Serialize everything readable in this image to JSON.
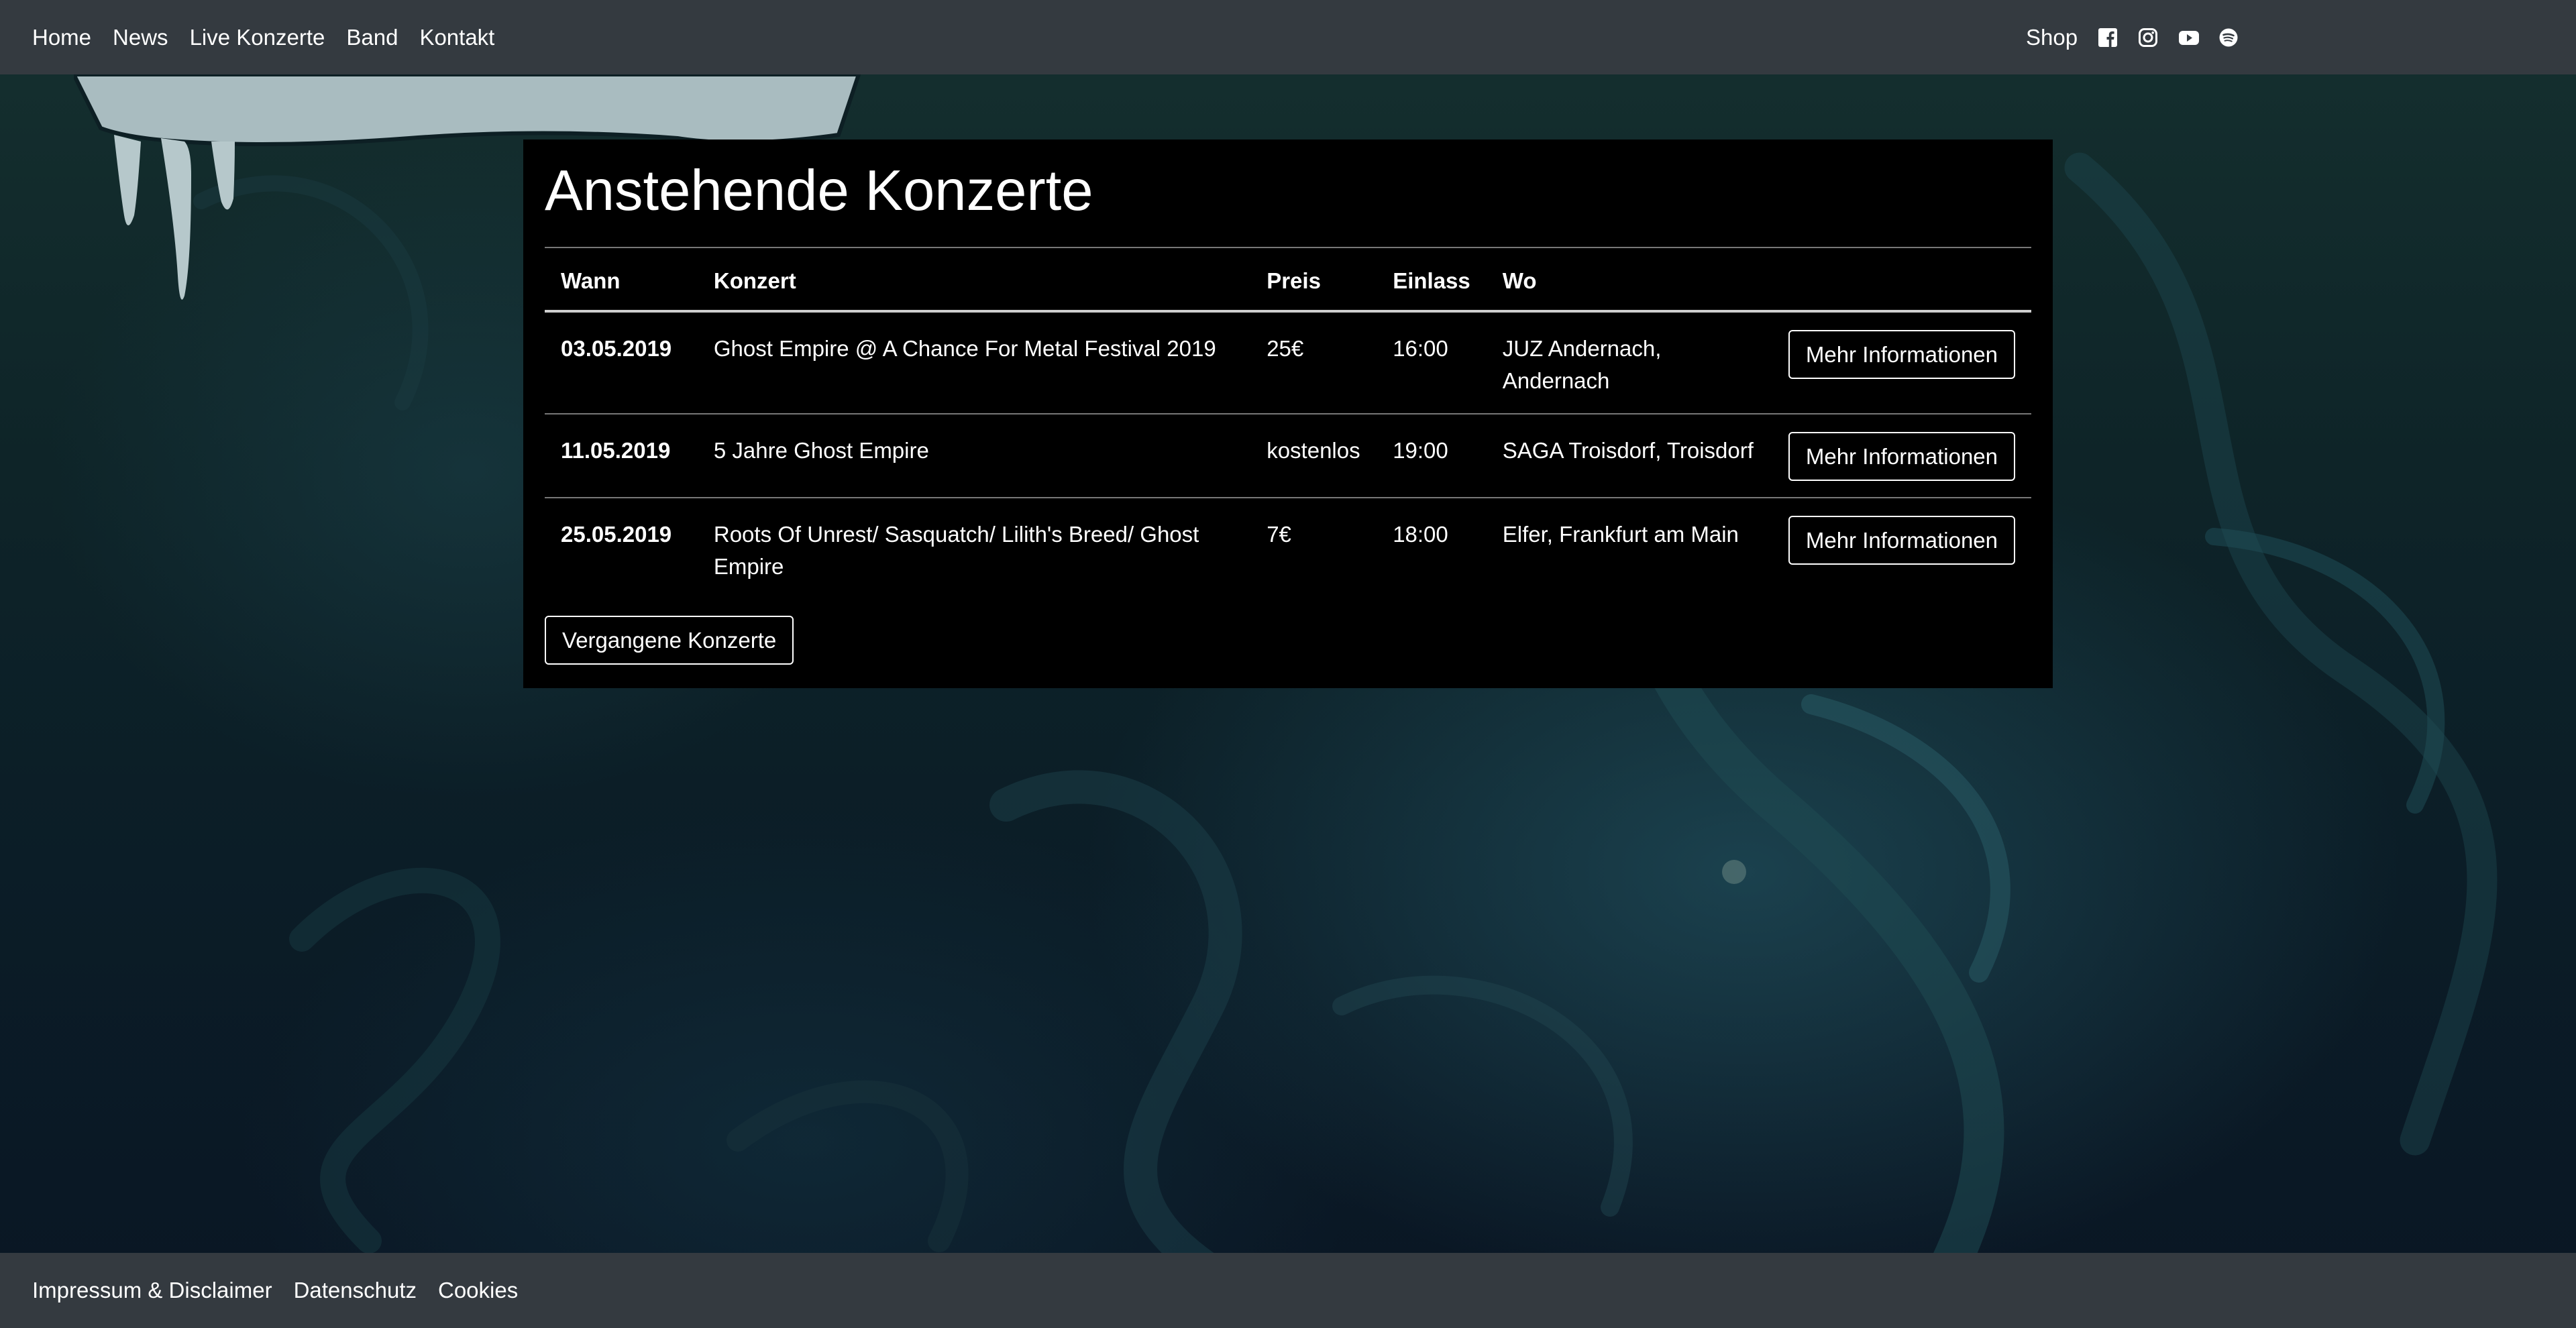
{
  "nav": {
    "items": [
      {
        "label": "Home"
      },
      {
        "label": "News"
      },
      {
        "label": "Live Konzerte"
      },
      {
        "label": "Band"
      },
      {
        "label": "Kontakt"
      }
    ],
    "shop_label": "Shop",
    "social": [
      {
        "icon": "facebook-icon"
      },
      {
        "icon": "instagram-icon"
      },
      {
        "icon": "youtube-icon"
      },
      {
        "icon": "spotify-icon"
      }
    ]
  },
  "main": {
    "title": "Anstehende Konzerte",
    "columns": [
      "Wann",
      "Konzert",
      "Preis",
      "Einlass",
      "Wo"
    ],
    "rows": [
      {
        "date": "03.05.2019",
        "concert": "Ghost Empire @ A Chance For Metal Festival 2019",
        "price": "25€",
        "entry": "16:00",
        "location": "JUZ Andernach, Andernach",
        "button": "Mehr Informationen"
      },
      {
        "date": "11.05.2019",
        "concert": "5 Jahre Ghost Empire",
        "price": "kostenlos",
        "entry": "19:00",
        "location": "SAGA Troisdorf, Troisdorf",
        "button": "Mehr Informationen"
      },
      {
        "date": "25.05.2019",
        "concert": "Roots Of Unrest/ Sasquatch/ Lilith's Breed/ Ghost Empire",
        "price": "7€",
        "entry": "18:00",
        "location": "Elfer, Frankfurt am Main",
        "button": "Mehr Informationen"
      }
    ],
    "past_button": "Vergangene Konzerte"
  },
  "footer": {
    "links": [
      {
        "label": "Impressum & Disclaimer"
      },
      {
        "label": "Datenschutz"
      },
      {
        "label": "Cookies"
      }
    ]
  },
  "colors": {
    "navbar_bg": "#343a40",
    "panel_bg": "#000000",
    "text": "#ffffff"
  }
}
